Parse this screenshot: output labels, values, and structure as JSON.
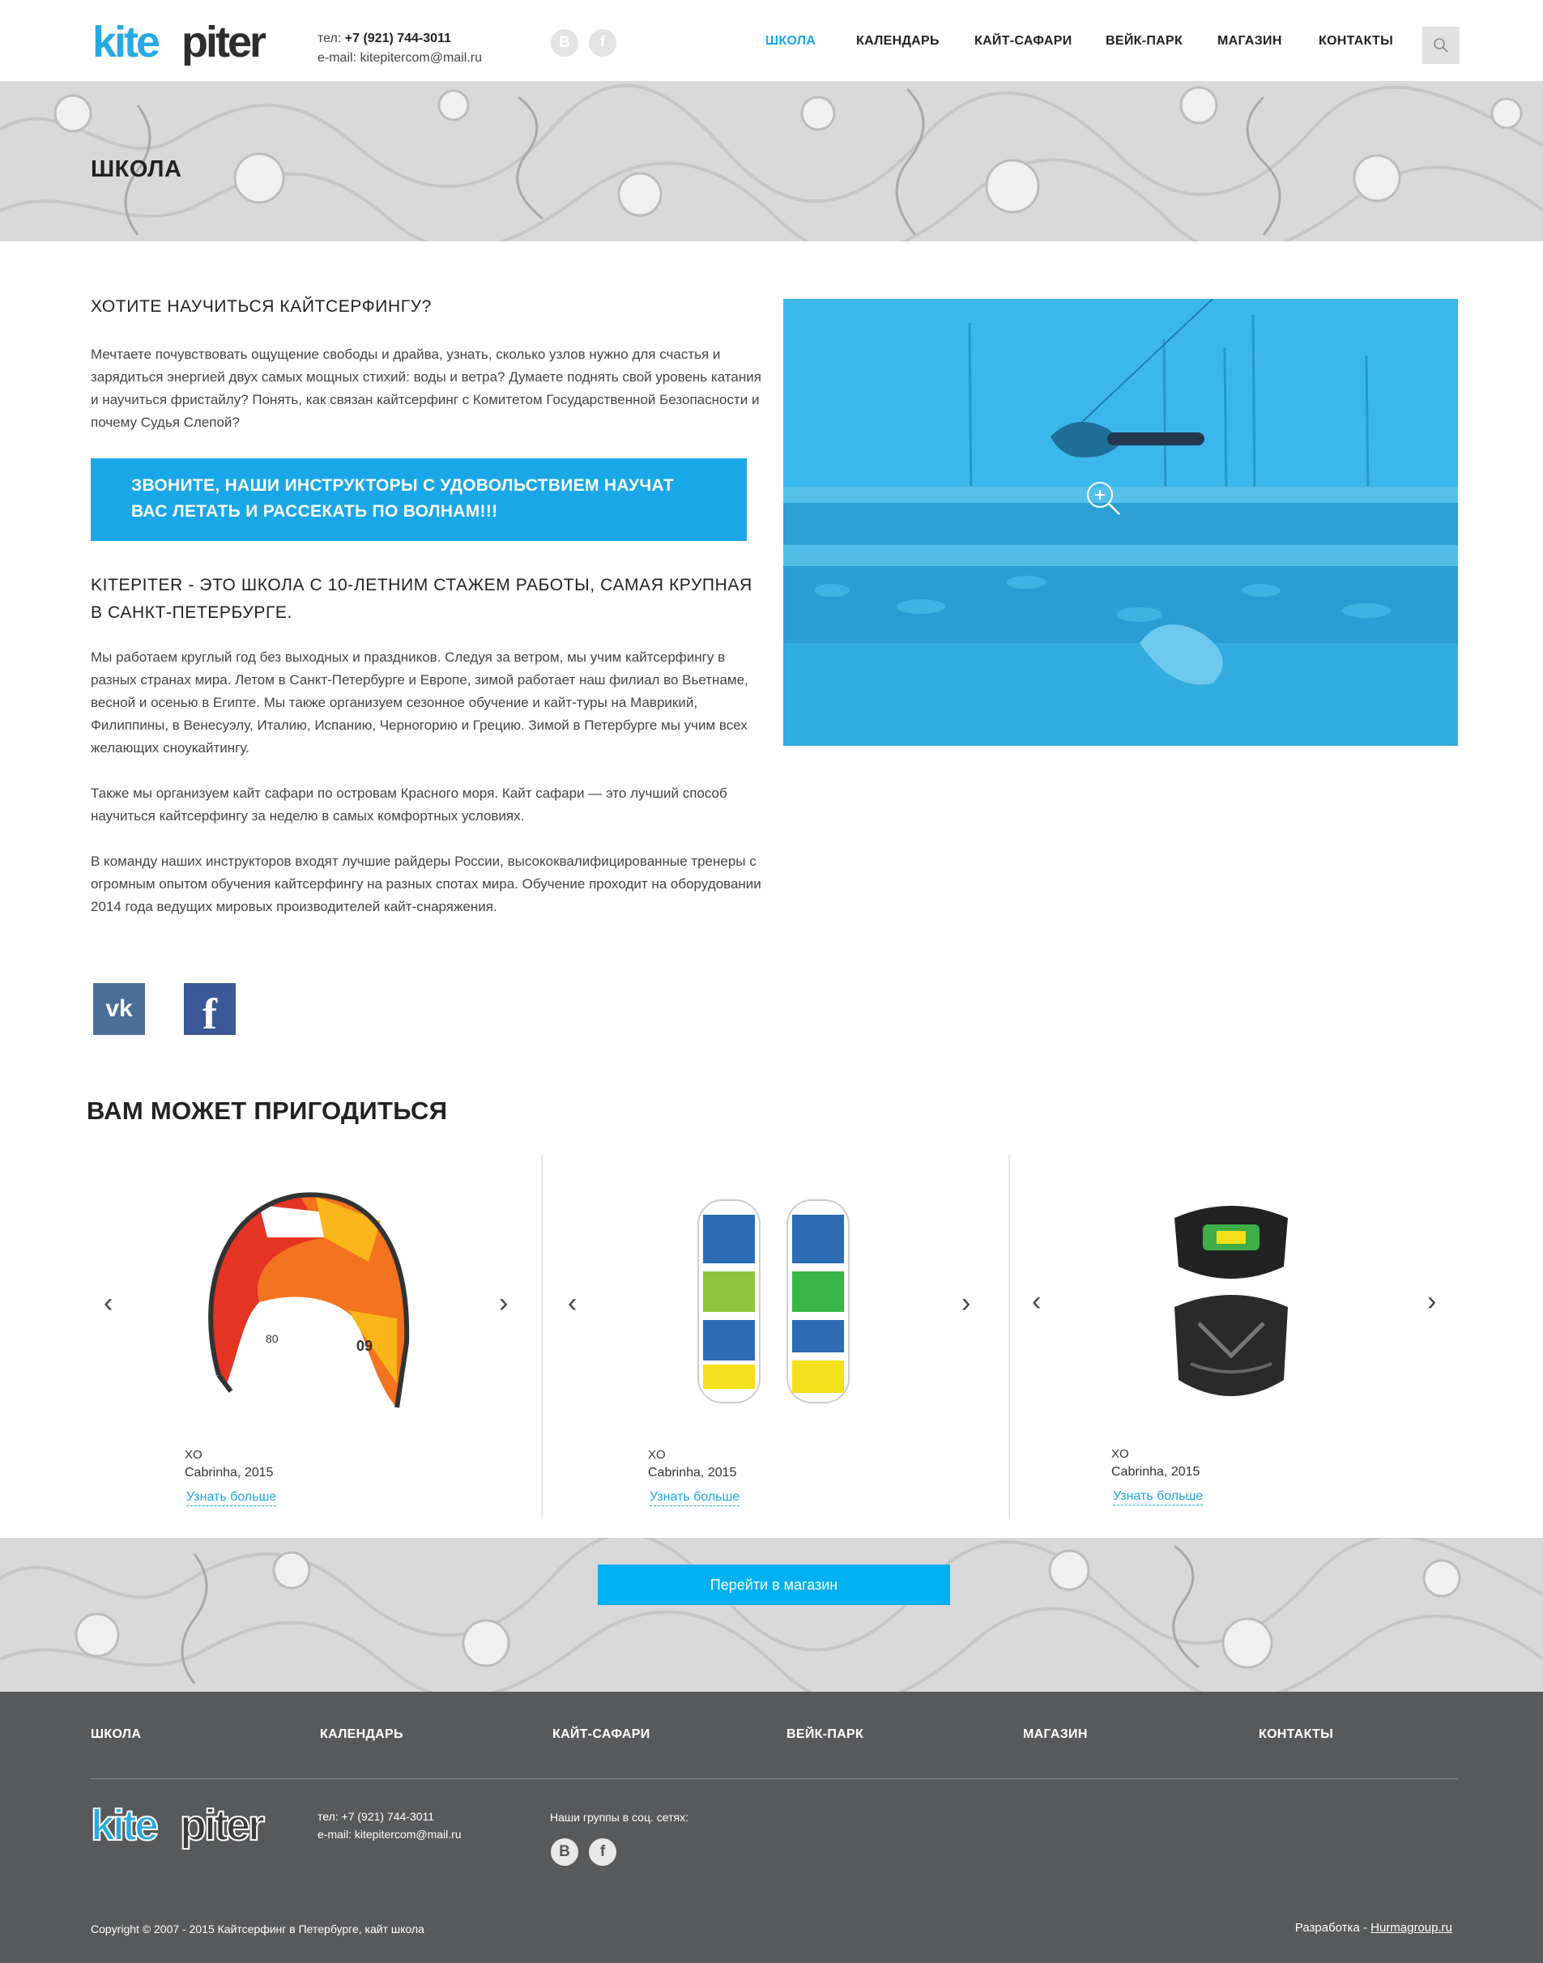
{
  "header": {
    "logo_text": "kitepiter",
    "phone_label": "тел:",
    "phone": "+7 (921) 744-3011",
    "email_label": "e-mail:",
    "email": "kitepitercom@mail.ru",
    "social": [
      "vk",
      "facebook"
    ],
    "nav": [
      {
        "label": "ШКОЛА",
        "active": true
      },
      {
        "label": "КАЛЕНДАРЬ",
        "active": false
      },
      {
        "label": "КАЙТ-САФАРИ",
        "active": false
      },
      {
        "label": "ВЕЙК-ПАРК",
        "active": false
      },
      {
        "label": "МАГАЗИН",
        "active": false
      },
      {
        "label": "КОНТАКТЫ",
        "active": false
      }
    ],
    "search_icon": "search-icon"
  },
  "page": {
    "title": "ШКОЛА"
  },
  "intro": {
    "heading": "ХОТИТЕ НАУЧИТЬСЯ КАЙТСЕРФИНГУ?",
    "text": "Мечтаете почувствовать ощущение свободы и драйва, узнать, сколько узлов нужно для счастья и зарядиться энергией двух самых мощных стихий: воды и ветра? Думаете поднять свой уровень катания и научиться фристайлу? Понять, как связан кайтсерфинг с Комитетом Государственной Безопасности и почему Судья Слепой?",
    "cta": "ЗВОНИТЕ, НАШИ ИНСТРУКТОРЫ С УДОВОЛЬСТВИЕМ НАУЧАТ ВАС ЛЕТАТЬ И РАССЕКАТЬ ПО ВОЛНАМ!!!"
  },
  "about": {
    "heading_line1": "KITEPITER - ЭТО ШКОЛА С 10-ЛЕТНИМ СТАЖЕМ РАБОТЫ, САМАЯ КРУПНАЯ",
    "heading_line2": "В САНКТ-ПЕТЕРБУРГЕ.",
    "paragraphs": [
      "Мы работаем круглый год без выходных и праздников. Следуя за ветром, мы учим кайтсерфингу в разных странах мира. Летом в Санкт-Петербурге и Европе, зимой работает наш филиал во Вьетнаме, весной и осенью в Египте. Мы также организуем сезонное обучение и кайт-туры на Маврикий, Филиппины, в Венесуэлу, Италию, Испанию, Черногорию и Грецию. Зимой в Петербурге мы учим всех желающих сноукайтингу.",
      "Также мы организуем кайт сафари по островам Красного моря. Кайт сафари — это лучший способ научиться кайтсерфингу за неделю в самых комфортных условиях.",
      "В команду наших инструкторов входят лучшие райдеры России, высококвалифицированные тренеры с огромным опытом обучения кайтсерфингу на разных спотах мира. Обучение проходит на оборудовании 2014 года ведущих мировых производителей кайт-снаряжения."
    ]
  },
  "share": {
    "vk_glyph": "vk",
    "fb_glyph": "f"
  },
  "related": {
    "title": "ВАМ МОЖЕТ ПРИГОДИТЬСЯ",
    "products": [
      {
        "brand": "XO",
        "name": "Cabrinha, 2015",
        "link": "Узнать больше",
        "image": "kite"
      },
      {
        "brand": "XO",
        "name": "Cabrinha, 2015",
        "link": "Узнать больше",
        "image": "wakeboards"
      },
      {
        "brand": "XO",
        "name": "Cabrinha, 2015",
        "link": "Узнать больше",
        "image": "harness"
      }
    ],
    "shop_button": "Перейти в магазин"
  },
  "footer": {
    "nav": [
      "ШКОЛА",
      "КАЛЕНДАРЬ",
      "КАЙТ-САФАРИ",
      "ВЕЙК-ПАРК",
      "МАГАЗИН",
      "КОНТАКТЫ"
    ],
    "phone_line": "тел: +7 (921) 744-3011",
    "email_line": "e-mail: kitepitercom@mail.ru",
    "social_label": "Наши группы в соц. сетях:",
    "copyright": "Copyright © 2007 - 2015 Кайтсерфинг в Петербурге, кайт школа",
    "dev_label": "Разработка - ",
    "dev_link": "Hurmagroup.ru"
  },
  "colors": {
    "accent": "#1aa7e8",
    "button": "#00b0f0",
    "footer_bg": "#58595b",
    "pattern_bg": "#d9d9d9"
  }
}
